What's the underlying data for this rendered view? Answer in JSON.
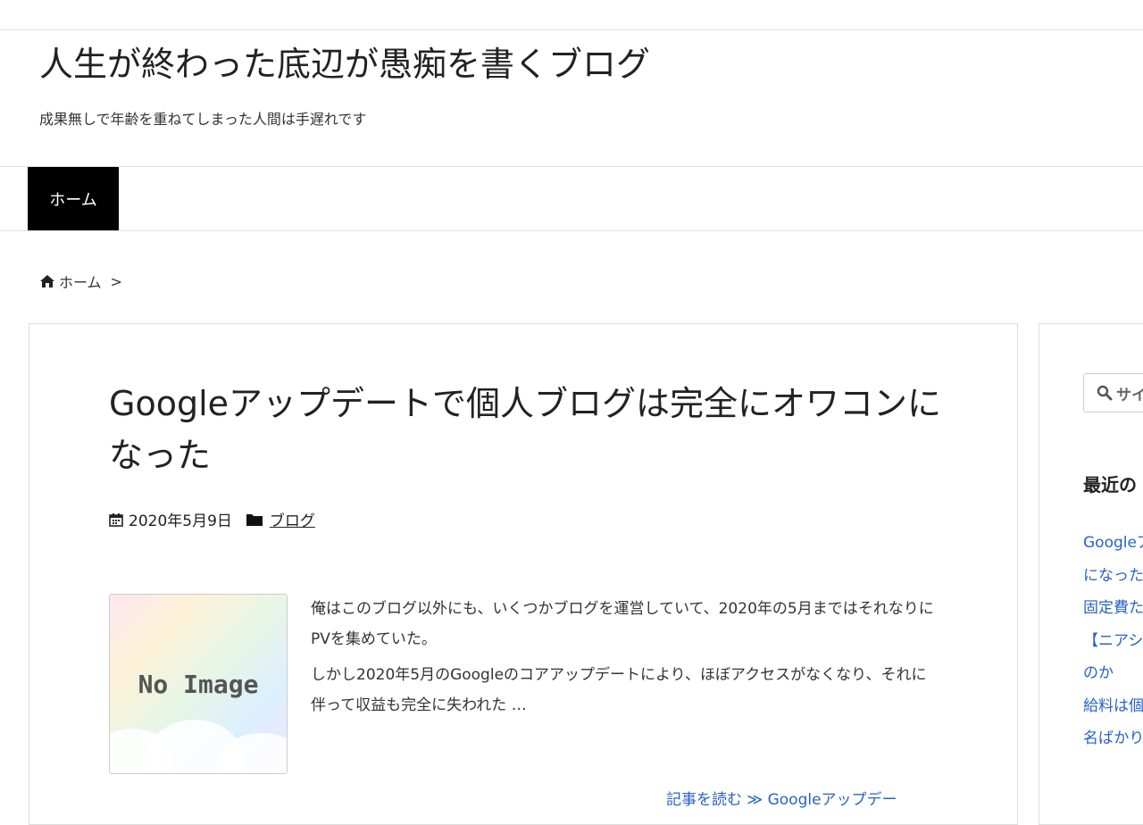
{
  "site": {
    "title": "人生が終わった底辺が愚痴を書くブログ",
    "description": "成果無しで年齢を重ねてしまった人間は手遅れです"
  },
  "nav": {
    "home_label": "ホーム"
  },
  "breadcrumb": {
    "home_label": "ホーム",
    "separator": ">"
  },
  "post": {
    "title": "Googleアップデートで個人ブログは完全にオワコンになった",
    "date": "2020年5月9日",
    "category": "ブログ",
    "thumbnail_text": "No Image",
    "excerpt": [
      "俺はこのブログ以外にも、いくつかブログを運営していて、2020年の5月まではそれなりにPVを集めていた。",
      "しかし2020年5月のGoogleのコアアップデートにより、ほぼアクセスがなくなり、それに伴って収益も完全に失われた …"
    ],
    "read_more": "記事を読む ≫ Googleアップデー"
  },
  "sidebar": {
    "search_placeholder": "サイ",
    "recent_heading": "最近の",
    "recent_items": [
      "Googleア",
      "になった",
      "固定費た",
      "【ニアシ",
      "のか",
      "給料は個",
      "名ばかり"
    ]
  },
  "colors": {
    "link": "#2962c8",
    "nav_bg": "#000000",
    "border": "#dddddd"
  }
}
